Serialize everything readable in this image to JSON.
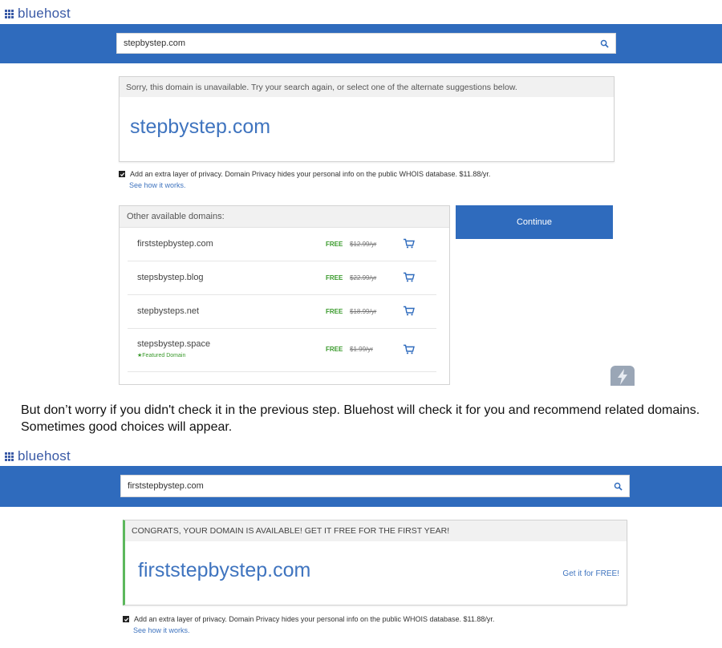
{
  "shot1": {
    "logo_text": "bluehost",
    "search": {
      "value": "stepbystep.com"
    },
    "status_message": "Sorry, this domain is unavailable. Try your search again, or select one of the alternate suggestions below.",
    "domain": "stepbystep.com",
    "privacy": {
      "text": "Add an extra layer of privacy. Domain Privacy hides your personal info on the public WHOIS database. $11.88/yr.",
      "link": "See how it works."
    },
    "other_domains": {
      "title": "Other available domains:",
      "items": [
        {
          "name": "firststepbystep.com",
          "free": "FREE",
          "price": "$12.99/yr"
        },
        {
          "name": "stepsbystep.blog",
          "free": "FREE",
          "price": "$22.99/yr"
        },
        {
          "name": "stepbysteps.net",
          "free": "FREE",
          "price": "$18.99/yr"
        },
        {
          "name": "stepsbystep.space",
          "free": "FREE",
          "price": "$1.99/yr",
          "featured": "★Featured Domain"
        }
      ]
    },
    "continue_label": "Continue"
  },
  "article_text": "But don’t worry if you didn't check it in the previous step. Bluehost will check it for you and recommend related domains. Sometimes good choices will appear.",
  "shot2": {
    "logo_text": "bluehost",
    "search": {
      "value": "firststepbystep.com"
    },
    "status_message": "CONGRATS, YOUR DOMAIN IS AVAILABLE! GET IT FREE FOR THE FIRST YEAR!",
    "domain": "firststepbystep.com",
    "cta": "Get it for FREE!",
    "privacy": {
      "text": "Add an extra layer of privacy. Domain Privacy hides your personal info on the public WHOIS database. $11.88/yr.",
      "link": "See how it works."
    }
  },
  "colors": {
    "brand_blue": "#2f6bbd",
    "link_blue": "#3f74bf",
    "success_green": "#3a9a2c",
    "available_border": "#5cb85c"
  },
  "icons": [
    "logo-grid-icon",
    "search-icon",
    "checkbox-checked-icon",
    "cart-icon",
    "scroll-app-icon"
  ]
}
